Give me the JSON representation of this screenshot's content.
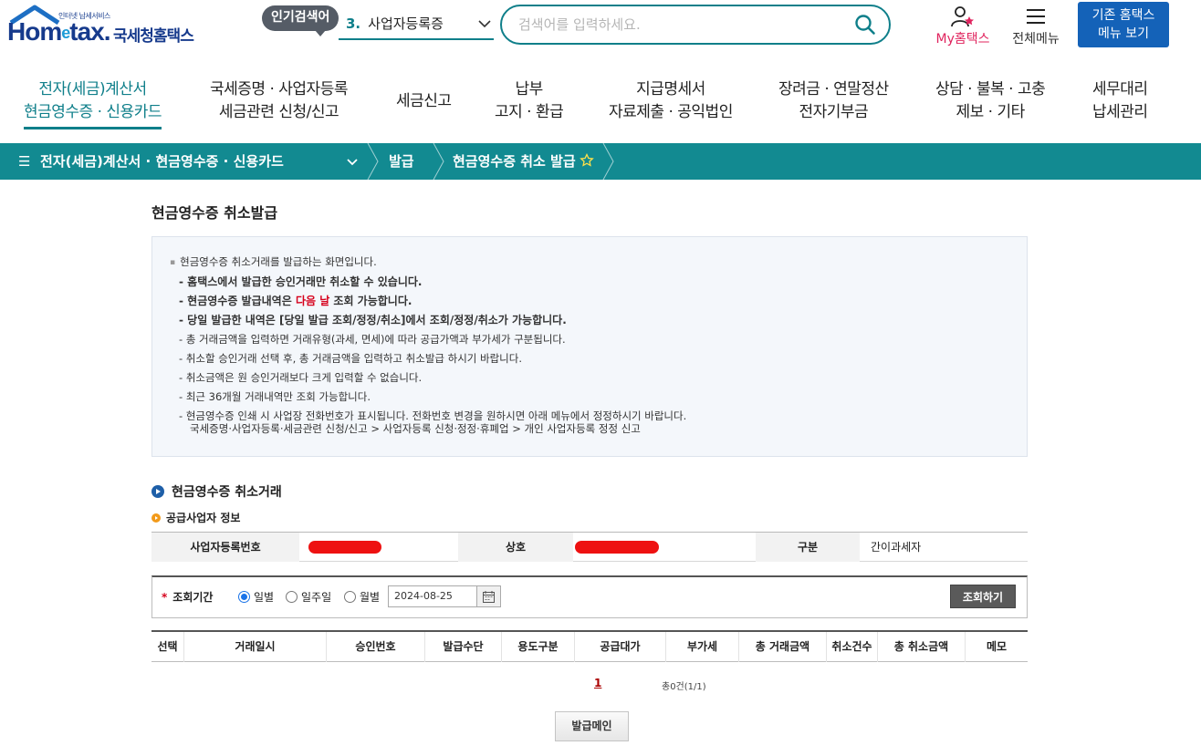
{
  "header": {
    "logo_small": "인터넷 납세서비스",
    "logo_main_1": "Hom",
    "logo_main_e": "e",
    "logo_main_2": "tax.",
    "logo_kor": "국세청홈택스",
    "popular_badge": "인기검색어",
    "popular_num": "3.",
    "popular_term": "사업자등록증",
    "search_placeholder": "검색어를 입력하세요.",
    "my_hometax": "My홈택스",
    "all_menu": "전체메뉴",
    "legacy_line1": "기존 홈택스",
    "legacy_line2": "메뉴 보기"
  },
  "gnb": [
    {
      "line1": "전자(세금)계산서",
      "line2": "현금영수증 · 신용카드"
    },
    {
      "line1": "국세증명 · 사업자등록",
      "line2": "세금관련 신청/신고"
    },
    {
      "line1": "세금신고",
      "line2": ""
    },
    {
      "line1": "납부",
      "line2": "고지 · 환급"
    },
    {
      "line1": "지급명세서",
      "line2": "자료제출 · 공익법인"
    },
    {
      "line1": "장려금 · 연말정산",
      "line2": "전자기부금"
    },
    {
      "line1": "상담 · 불복 · 고충",
      "line2": "제보 · 기타"
    },
    {
      "line1": "세무대리",
      "line2": "납세관리"
    }
  ],
  "location": {
    "menu": "전자(세금)계산서 · 현금영수증 · 신용카드",
    "crumb1": "발급",
    "crumb2": "현금영수증 취소 발급"
  },
  "page": {
    "title": "현금영수증 취소발급"
  },
  "guide": {
    "head": "현금영수증 취소거래를 발급하는 화면입니다.",
    "b1": "홈택스에서 발급한 승인거래만 취소할 수 있습니다.",
    "b2_pre": "현금영수증 발급내역은 ",
    "b2_red": "다음 날",
    "b2_post": " 조회 가능합니다.",
    "b3": "당일 발급한 내역은 [당일 발급 조회/정정/취소]에서 조회/정정/취소가 가능합니다.",
    "n1": "총 거래금액을 입력하면 거래유형(과세, 면세)에 따라 공급가액과 부가세가 구분됩니다.",
    "n2": "취소할 승인거래 선택 후, 총 거래금액을 입력하고 취소발급 하시기 바랍니다.",
    "n3": "취소금액은 원 승인거래보다 크게 입력할 수 없습니다.",
    "n4": "최근 36개월 거래내역만 조회 가능합니다.",
    "n5": "현금영수증 인쇄 시 사업장 전화번호가 표시됩니다. 전화번호 변경을 원하시면 아래 메뉴에서 정정하시기 바랍니다.",
    "n5_cont": "국세증명·사업자등록·세금관련 신청/신고 > 사업자등록 신청·정정·휴폐업 > 개인 사업자등록 정정 신고"
  },
  "section": {
    "title": "현금영수증 취소거래",
    "sub_title": "공급사업자 정보"
  },
  "supplier": {
    "reg_no_label": "사업자등록번호",
    "name_label": "상호",
    "type_label": "구분",
    "type_value": "간이과세자"
  },
  "search": {
    "label": "조회기간",
    "required_mark": "*",
    "radio_daily": "일별",
    "radio_weekly": "일주일",
    "radio_monthly": "월별",
    "date": "2024-08-25",
    "query_btn": "조회하기"
  },
  "table": {
    "columns": [
      "선택",
      "거래일시",
      "승인번호",
      "발급수단",
      "용도구분",
      "공급대가",
      "부가세",
      "총 거래금액",
      "취소건수",
      "총 취소금액",
      "메모"
    ]
  },
  "pager": {
    "page": "1",
    "total": "총0건(1/1)"
  },
  "bottom": {
    "main_btn": "발급메인"
  },
  "colors": {
    "teal": "#128a91",
    "navy": "#163a8c",
    "legacy_blue": "#1462b8",
    "accent_red": "#d6001c"
  }
}
